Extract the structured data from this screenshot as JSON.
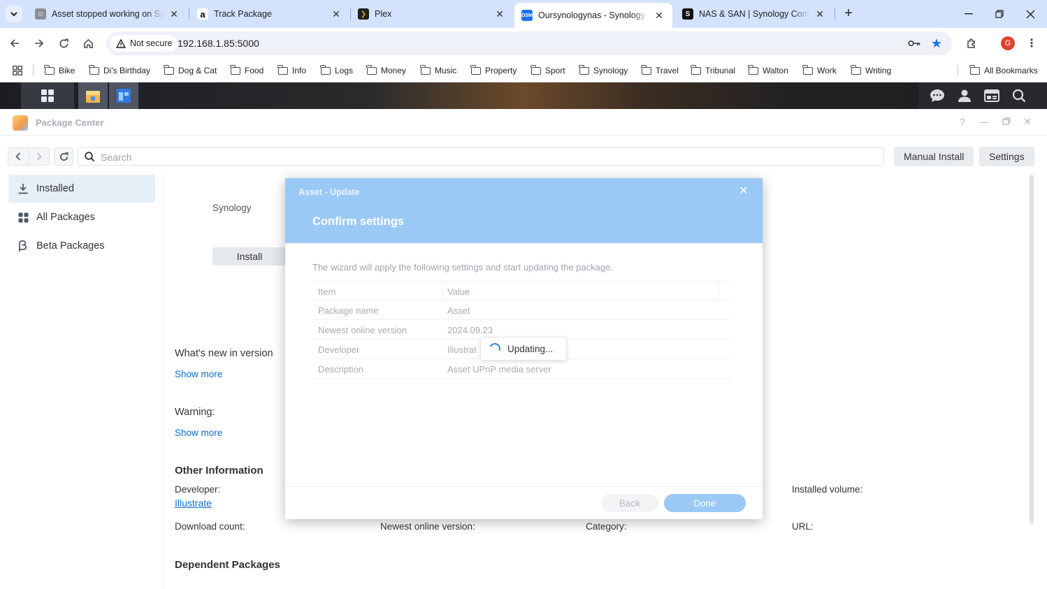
{
  "browser": {
    "tabs": [
      {
        "title": "Asset stopped working on Sync",
        "favicon": "asset-favicon"
      },
      {
        "title": "Track Package",
        "favicon": "amazon-favicon"
      },
      {
        "title": "Plex",
        "favicon": "plex-favicon"
      },
      {
        "title": "Oursynologynas - Synology Dis",
        "favicon": "dsm-favicon",
        "active": true
      },
      {
        "title": "NAS & SAN | Synology Commu",
        "favicon": "synology-favicon"
      }
    ],
    "security_label": "Not secure",
    "url": "192.168.1.85:5000",
    "profile_initial": "G",
    "bookmarks": [
      "Bike",
      "Di's Birthday",
      "Dog & Cat",
      "Food",
      "Info",
      "Logs",
      "Money",
      "Music",
      "Property",
      "Sport",
      "Synology",
      "Travel",
      "Tribunal",
      "Walton",
      "Work",
      "Writing"
    ],
    "all_bookmarks": "All Bookmarks"
  },
  "package_center": {
    "title": "Package Center",
    "search_placeholder": "Search",
    "manual_install": "Manual Install",
    "settings": "Settings",
    "sidebar": [
      {
        "label": "Installed",
        "icon": "download-icon",
        "active": true
      },
      {
        "label": "All Packages",
        "icon": "grid-icon"
      },
      {
        "label": "Beta Packages",
        "icon": "beta-icon"
      }
    ],
    "detail": {
      "publisher": "Synology",
      "install_button": "Install",
      "whats_new": "What's new in version",
      "show_more_1": "Show more",
      "warning": "Warning:",
      "show_more_2": "Show more",
      "other_info_heading": "Other Information",
      "developer_label": "Developer:",
      "developer_value": "Illustrate",
      "installed_volume_label": "Installed volume:",
      "download_count_label": "Download count:",
      "newest_version_label": "Newest online version:",
      "category_label": "Category:",
      "url_label": "URL:",
      "dependent_heading": "Dependent Packages"
    }
  },
  "dialog": {
    "window_title": "Asset - Update",
    "heading": "Confirm settings",
    "description": "The wizard will apply the following settings and start updating the package.",
    "columns": {
      "item": "Item",
      "value": "Value"
    },
    "rows": [
      {
        "item": "Package name",
        "value": "Asset"
      },
      {
        "item": "Newest online version",
        "value": "2024.09.23"
      },
      {
        "item": "Developer",
        "value": "Illustrat"
      },
      {
        "item": "Description",
        "value": "Asset UPnP media server"
      }
    ],
    "toast": "Updating...",
    "back": "Back",
    "done": "Done"
  },
  "colors": {
    "dialog_header": "#9ac9f6",
    "link": "#0c6fcc",
    "tab_strip": "#d3e3fd"
  }
}
